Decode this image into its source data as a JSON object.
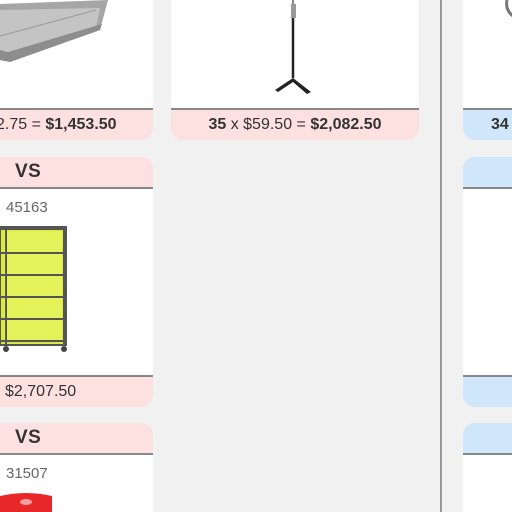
{
  "cards": {
    "top_left": {
      "price": {
        "rest": "2.75 = ",
        "total": "$1,453.50"
      }
    },
    "top_middle": {
      "price": {
        "qty": "35",
        "times": " x ",
        "unit": "$59.50",
        "equals": " = ",
        "total": "$2,082.50"
      }
    },
    "top_right": {
      "price": {
        "qty": "34"
      }
    },
    "mid_left": {
      "vs_label": "VS",
      "sku": "45163",
      "price": {
        "total": "$2,707.50"
      }
    },
    "bottom_left": {
      "vs_label": "VS",
      "sku": "31507"
    }
  },
  "colors": {
    "pink": "#fde0e0",
    "blue": "#cfe6fb",
    "shelf_yellow": "#d7e83a",
    "chair_red": "#e8272b"
  }
}
